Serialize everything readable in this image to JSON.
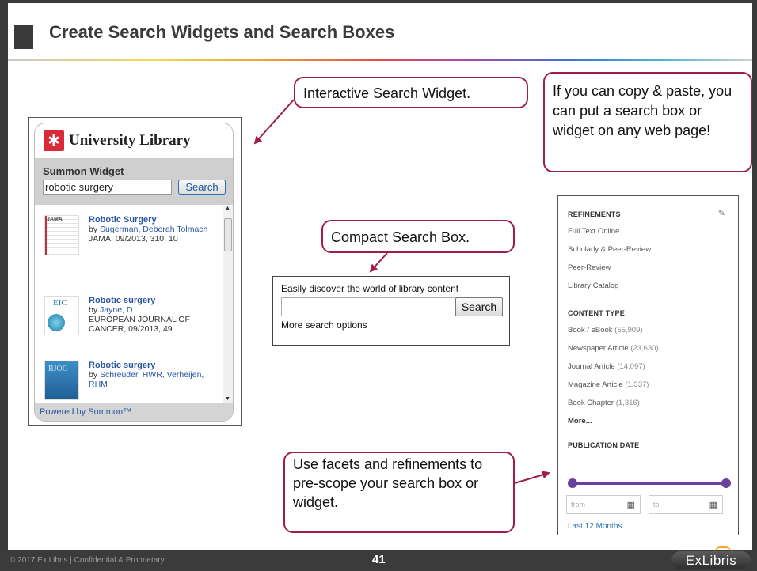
{
  "slide": {
    "title": "Create Search Widgets and Search Boxes",
    "page_number": "41",
    "footer_copyright": "© 2017 Ex Libris | Confidential & Proprietary",
    "brand": "ExLibris"
  },
  "callouts": {
    "interactive": "Interactive Search Widget.",
    "copy_paste": "If you can copy & paste, you can put a search box or widget on any web page!",
    "compact": "Compact Search  Box.",
    "facets": "Use facets and refinements to pre-scope your search box or widget."
  },
  "widget": {
    "brand": "University Library",
    "label": "Summon Widget",
    "search_value": "robotic surgery",
    "search_button": "Search",
    "results": [
      {
        "title": "Robotic Surgery",
        "by": "by ",
        "authors": "Sugerman, Deborah Tolmach",
        "meta": "JAMA, 09/2013,                310, 10",
        "thumb": "jama-cover-icon"
      },
      {
        "title": "Robotic surgery",
        "by": "by ",
        "authors": "Jayne, D",
        "meta": "EUROPEAN JOURNAL OF CANCER, 09/2013,            49",
        "thumb": "ejc-cover-icon"
      },
      {
        "title": "Robotic surgery",
        "by": "by ",
        "authors": "Schreuder, HWR, Verheijen, RHM",
        "meta": "",
        "thumb": "bjog-cover-icon"
      }
    ],
    "footer": "Powered by Summon™"
  },
  "compact": {
    "title": "Easily discover the world of library content",
    "search_button": "Search",
    "more": "More search options"
  },
  "facets": {
    "refinements_head": "REFINEMENTS",
    "refinements": [
      "Full Text Online",
      "Scholarly & Peer-Review",
      "Peer-Review",
      "Library Catalog"
    ],
    "content_type_head": "CONTENT TYPE",
    "content_types": [
      {
        "label": "Book / eBook",
        "count": "(55,909)"
      },
      {
        "label": "Newspaper Article",
        "count": "(23,630)"
      },
      {
        "label": "Journal Article",
        "count": "(14,097)"
      },
      {
        "label": "Magazine Article",
        "count": "(1,337)"
      },
      {
        "label": "Book Chapter",
        "count": "(1,316)"
      }
    ],
    "more": "More...",
    "pubdate_head": "PUBLICATION DATE",
    "from_placeholder": "from",
    "to_placeholder": "to",
    "last": "Last 12 Months"
  },
  "colors": {
    "callout_border": "#a01e46",
    "link_blue": "#2a55a5",
    "slider_purple": "#6b3fa0",
    "logo_red": "#d92a3a"
  }
}
